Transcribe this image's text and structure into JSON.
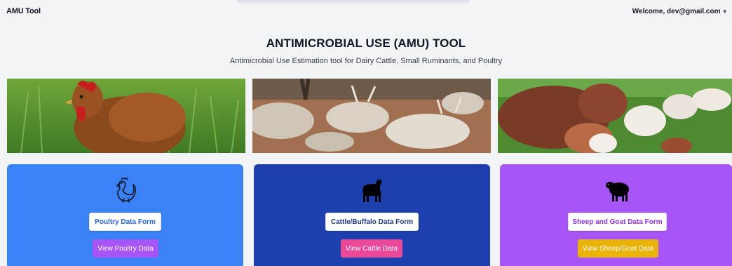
{
  "header": {
    "app_title": "AMU Tool",
    "welcome_text": "Welcome, dev@gmail.com",
    "menu_icon": "chevron-down-icon"
  },
  "hero": {
    "title": "ANTIMICROBIAL USE (AMU) TOOL",
    "subtitle": "Antimicrobial Use Estimation tool for Dairy Cattle, Small Ruminants, and Poultry"
  },
  "photos": [
    {
      "subject": "chicken in grass"
    },
    {
      "subject": "herd of cattle resting"
    },
    {
      "subject": "goats grazing"
    }
  ],
  "cards": [
    {
      "icon": "chicken-icon",
      "form_label": "Poultry Data Form",
      "view_label": "View Poultry Data",
      "bg_color": "#3b82f6",
      "form_text_color": "#2563eb",
      "view_color": "#a855f7"
    },
    {
      "icon": "cow-icon",
      "form_label": "Cattle/Buffalo Data Form",
      "view_label": "View Cattle Data",
      "bg_color": "#1e40af",
      "form_text_color": "#1e3a8a",
      "view_color": "#ec4899"
    },
    {
      "icon": "sheep-icon",
      "form_label": "Sheep and Goat Data Form",
      "view_label": "View Sheep/Goat Data",
      "bg_color": "#a855f7",
      "form_text_color": "#9333ea",
      "view_color": "#eab308"
    }
  ]
}
